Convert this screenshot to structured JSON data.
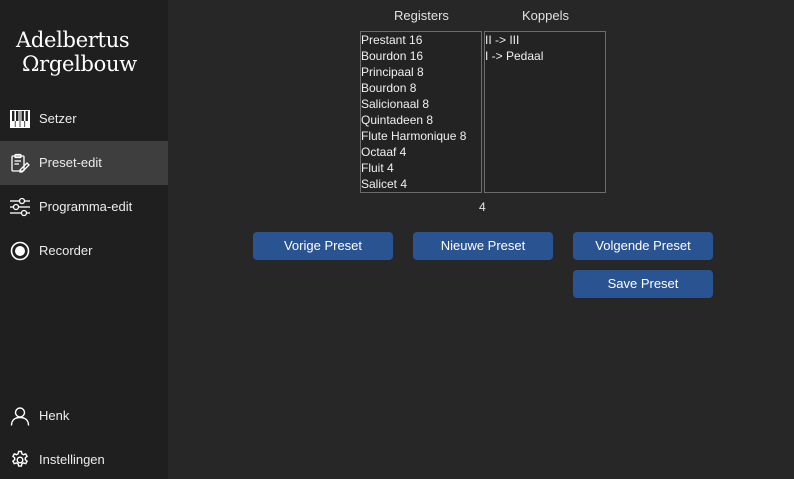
{
  "brand": {
    "line1": "Adelbertus",
    "line2": "Ωrgelbouw"
  },
  "sidebar": {
    "items": [
      {
        "label": "Setzer",
        "icon": "piano-keys-icon"
      },
      {
        "label": "Preset-edit",
        "icon": "clipboard-edit-icon",
        "active": true
      },
      {
        "label": "Programma-edit",
        "icon": "sliders-icon"
      },
      {
        "label": "Recorder",
        "icon": "record-icon"
      }
    ],
    "bottom": [
      {
        "label": "Henk",
        "icon": "user-icon"
      },
      {
        "label": "Instellingen",
        "icon": "gear-icon"
      }
    ]
  },
  "registers": {
    "header": "Registers",
    "items": [
      "Prestant 16",
      "Bourdon 16",
      "Principaal 8",
      "Bourdon 8",
      "Salicionaal 8",
      "Quintadeen 8",
      "Flute Harmonique 8",
      "Octaaf 4",
      "Fluit 4",
      "Salicet 4"
    ]
  },
  "koppels": {
    "header": "Koppels",
    "items": [
      "II -> III",
      "I -> Pedaal"
    ]
  },
  "preset_number": "4",
  "buttons": {
    "previous": "Vorige Preset",
    "new": "Nieuwe Preset",
    "next": "Volgende Preset",
    "save": "Save Preset"
  },
  "colors": {
    "button_bg": "#2a5391",
    "active_nav_bg": "#3e3e3e",
    "main_bg": "#272727",
    "sidebar_bg": "#1f1f1f"
  }
}
